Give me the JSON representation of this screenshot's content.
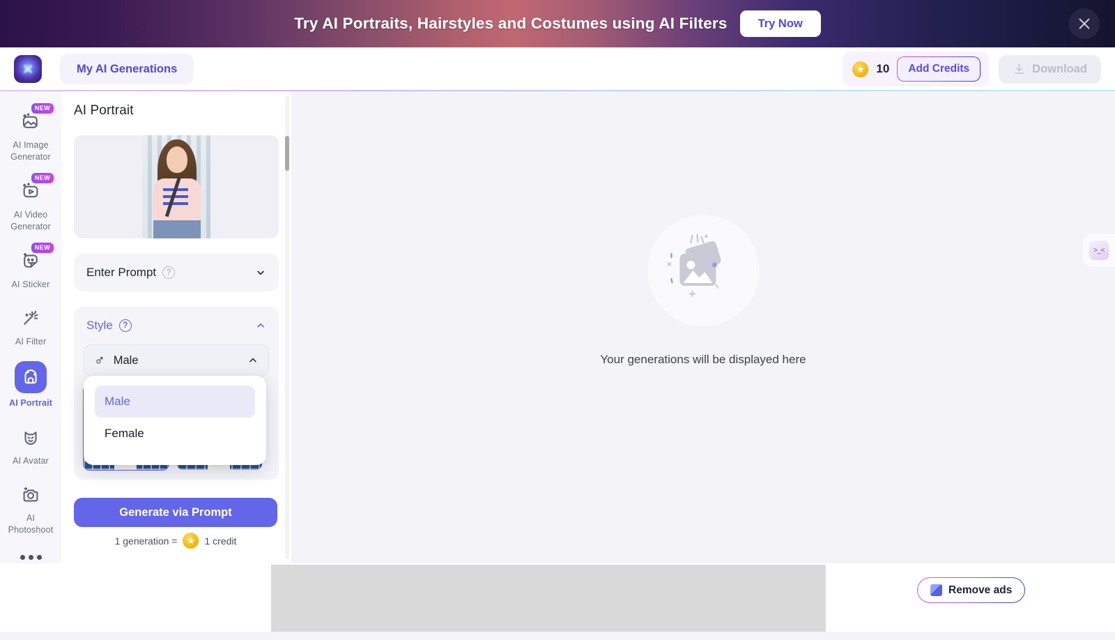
{
  "promo": {
    "text": "Try AI Portraits, Hairstyles and Costumes using AI Filters",
    "cta_label": "Try Now",
    "close_icon": "close-icon"
  },
  "header": {
    "logo_icon": "brand-logo-icon",
    "nav_label": "My AI Generations",
    "credits": {
      "icon": "coin-icon",
      "count": "10",
      "add_label": "Add Credits"
    },
    "download_label": "Download",
    "download_icon": "download-icon"
  },
  "sidebar": {
    "items": [
      {
        "label": "AI Image\nGenerator",
        "icon": "image-sparkle-icon",
        "badge": "NEW",
        "active": false
      },
      {
        "label": "AI Video\nGenerator",
        "icon": "video-play-icon",
        "badge": "NEW",
        "active": false
      },
      {
        "label": "AI Sticker",
        "icon": "sticker-face-icon",
        "badge": "NEW",
        "active": false
      },
      {
        "label": "AI Filter",
        "icon": "magic-wand-icon",
        "badge": "",
        "active": false
      },
      {
        "label": "AI Portrait",
        "icon": "portrait-icon",
        "badge": "",
        "active": true
      },
      {
        "label": "AI Avatar",
        "icon": "avatar-cat-icon",
        "badge": "",
        "active": false
      },
      {
        "label": "AI\nPhotoshoot",
        "icon": "camera-sparkle-icon",
        "badge": "",
        "active": false
      }
    ],
    "more_icon": "more-dots-icon"
  },
  "panel": {
    "title": "AI Portrait",
    "preview_alt": "uploaded-portrait-photo",
    "prompt_section": {
      "label": "Enter Prompt",
      "help_icon": "help-icon",
      "chevron": "chevron-down-icon",
      "expanded": false
    },
    "style_section": {
      "label": "Style",
      "help_icon": "help-icon",
      "chevron": "chevron-up-icon",
      "expanded": true,
      "select": {
        "symbol": "♂",
        "value": "Male",
        "chevron": "chevron-up-icon",
        "options": [
          "Male",
          "Female"
        ],
        "selected": "Male"
      },
      "thumbnails": [
        {
          "name": "style-thumb-1",
          "selected": true
        },
        {
          "name": "style-thumb-2",
          "selected": false
        }
      ]
    },
    "generate_label": "Generate via Prompt",
    "credit_note_prefix": "1 generation =",
    "credit_note_suffix": "1 credit",
    "credit_note_icon": "coin-icon"
  },
  "canvas": {
    "empty_icon": "gallery-placeholder-icon",
    "empty_text": "Your generations will be displayed here",
    "side_widget_icon": "collapse-widget-icon",
    "side_widget_glyph": ">_<"
  },
  "footer": {
    "ad_slot_label": "advertisement-slot",
    "remove_ads_label": "Remove ads",
    "remove_ads_icon": "remove-ads-icon"
  },
  "colors": {
    "accent": "#6366e8",
    "panel_bg": "#f4f4f9",
    "canvas_bg": "#f4f4f8",
    "rail_bg": "#f7f6fb",
    "badge_gradient_from": "#8f4ef0",
    "badge_gradient_to": "#d041e6"
  }
}
